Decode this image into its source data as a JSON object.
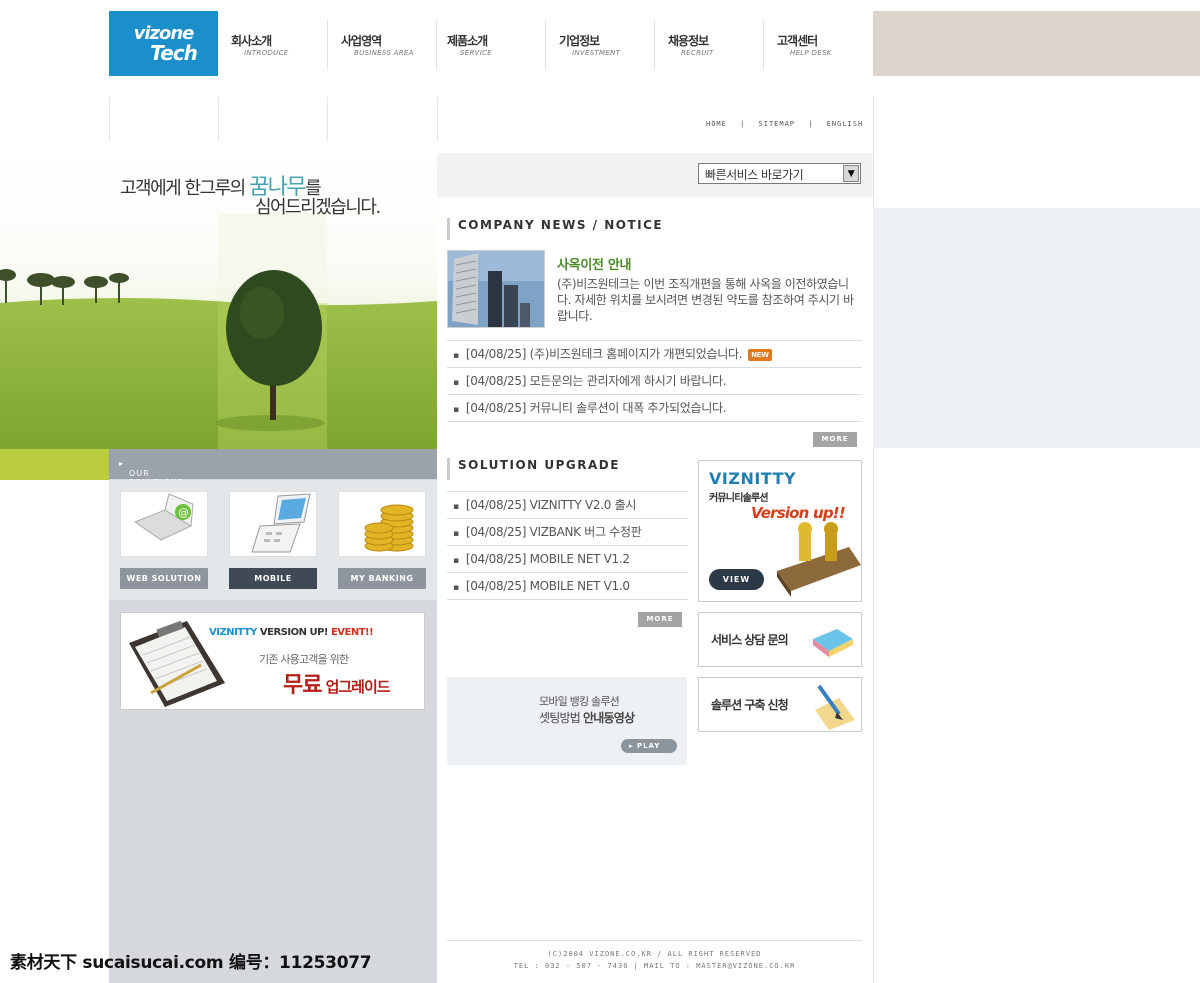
{
  "brand": {
    "logo_line1": "vizone",
    "logo_line2": "Tech",
    "colors": {
      "logo_bg": "#1a8fcb",
      "accent_green": "#b9cb3e"
    }
  },
  "nav": [
    {
      "ko": "회사소개",
      "en": "INTRODUCE"
    },
    {
      "ko": "사업영역",
      "en": "BUSINESS AREA"
    },
    {
      "ko": "제품소개",
      "en": "SERVICE"
    },
    {
      "ko": "기업정보",
      "en": "INVESTMENT"
    },
    {
      "ko": "채용정보",
      "en": "RECRUIT"
    },
    {
      "ko": "고객센터",
      "en": "HELP DESK"
    }
  ],
  "util": {
    "home": "HOME",
    "sep": "|",
    "sitemap": "SITEMAP",
    "english": "ENGLISH"
  },
  "hero": {
    "line1_a": "고객에게 한그루의 ",
    "line1_hl": "꿈나무",
    "line1_b": "를",
    "line2": "심어드리겠습니다."
  },
  "quick": {
    "selected": "빠른서비스 바로가기"
  },
  "solutions": {
    "header": "OUR SOLUTIONS",
    "items": [
      {
        "label": "WEB SOLUTION",
        "icon": "laptop-icon"
      },
      {
        "label": "MOBILE",
        "icon": "flip-phone-icon"
      },
      {
        "label": "MY BANKING",
        "icon": "coins-icon"
      }
    ]
  },
  "event": {
    "brand": "VIZNITTY",
    "text": "VERSION UP!",
    "event": "EVENT!!",
    "sub": "기존 사용고객을 위한",
    "free": "무료",
    "upgrade": "업그레이드"
  },
  "news": {
    "title": "COMPANY NEWS / NOTICE",
    "headline": "사옥이전 안내",
    "body": "(주)비즈원테크는 이번 조직개편을 통해 사옥을 이전하였습니다. 자세한 위치를 보시려면 변경된 약도를 참조하여 주시기 바랍니다.",
    "items": [
      {
        "date": "[04/08/25]",
        "text": "(주)비즈원테크 홈페이지가 개편되었습니다.",
        "badge": "NEW"
      },
      {
        "date": "[04/08/25]",
        "text": "모든문의는 관리자에게 하시기 바랍니다."
      },
      {
        "date": "[04/08/25]",
        "text": "커뮤니티 솔루션이 대폭 추가되었습니다."
      }
    ],
    "more": "MORE"
  },
  "upgrade": {
    "title": "SOLUTION UPGRADE",
    "items": [
      {
        "date": "[04/08/25]",
        "text": "VIZNITTY V2.0 출시"
      },
      {
        "date": "[04/08/25]",
        "text": "VIZBANK 버그 수정판"
      },
      {
        "date": "[04/08/25]",
        "text": "MOBILE NET V1.2"
      },
      {
        "date": "[04/08/25]",
        "text": "MOBILE NET V1.0"
      }
    ],
    "more": "MORE"
  },
  "viz": {
    "name": "VIZNITTY",
    "sub": "커뮤니티솔루션",
    "ver": "Version up!!",
    "view": "VIEW"
  },
  "service": {
    "label": "서비스 상담 문의"
  },
  "apply": {
    "label": "솔루션 구축 신청"
  },
  "mobile": {
    "line1": "모바일 뱅킹 솔루션",
    "line2a": "셋팅방법 ",
    "line2b": "안내동영상",
    "play": "PLAY"
  },
  "footer": {
    "copy": "(C)2004 VIZONE.CO.KR / ALL RIGHT RESERVED",
    "contact": "TEL : 032 - 507 - 7436 | MAIL TO : MASTER@VIZONE.CO.KR"
  },
  "watermark": {
    "text": "素材天下 sucaisucai.com  编号：11253077"
  }
}
